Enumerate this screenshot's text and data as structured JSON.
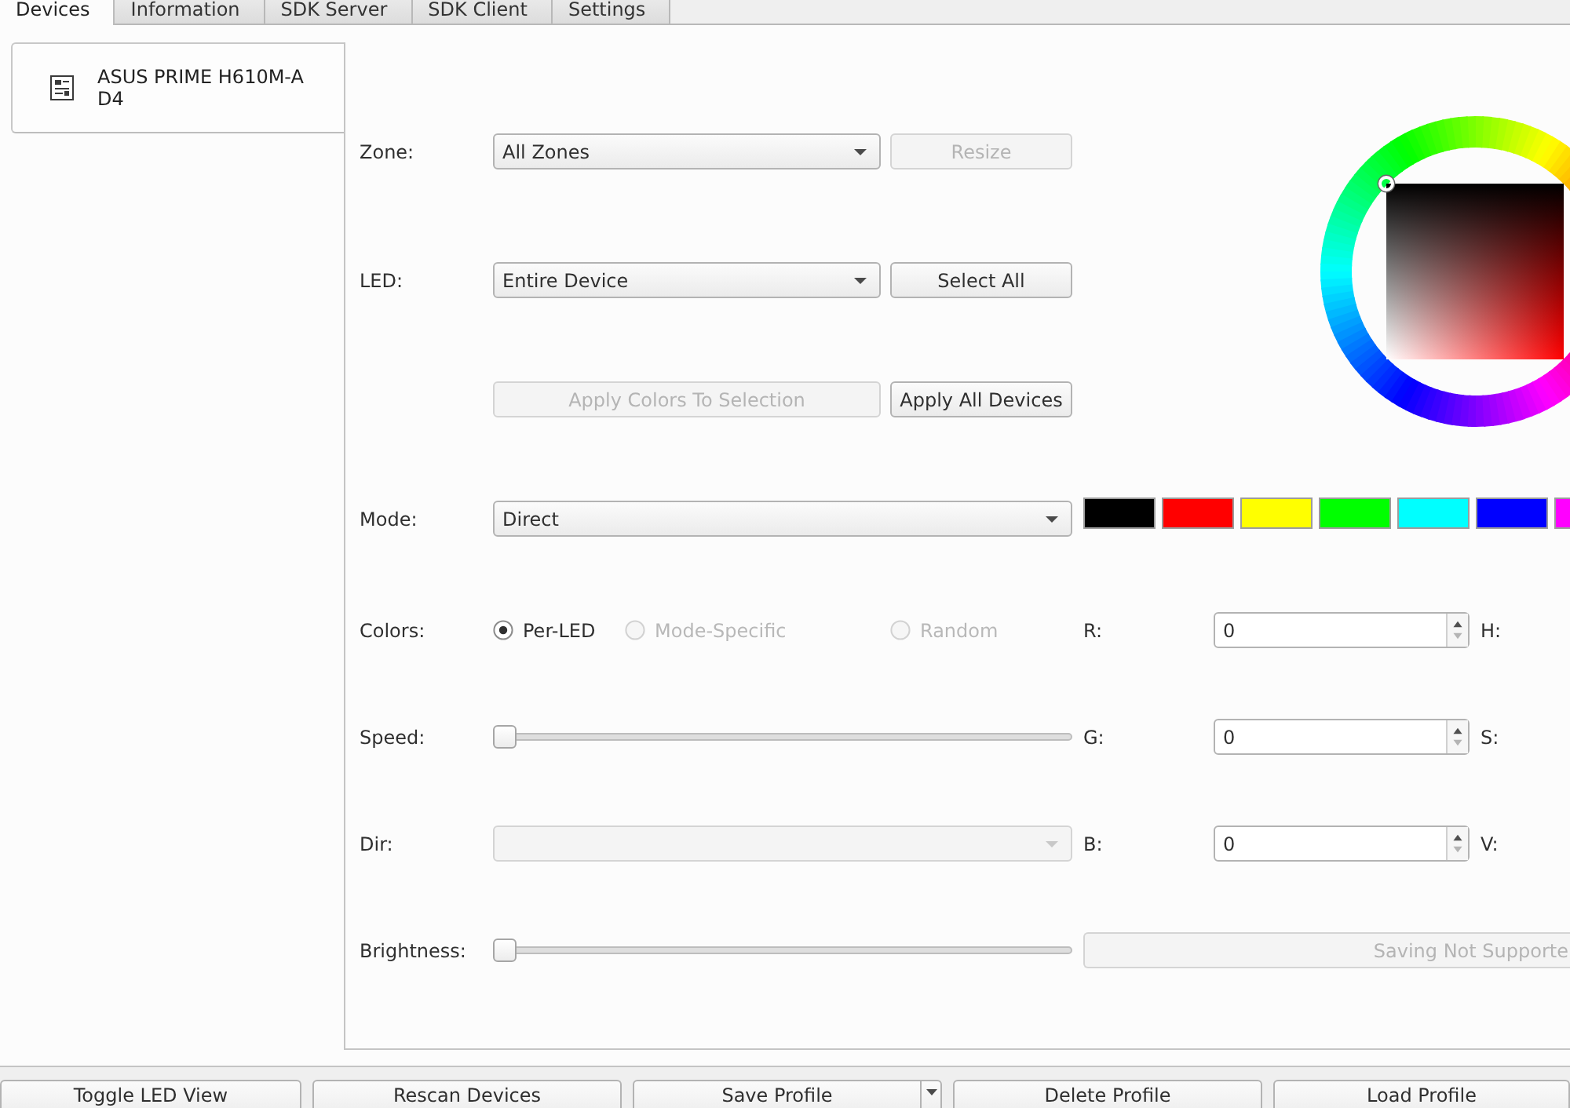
{
  "tabs": [
    {
      "label": "Devices",
      "selected": true
    },
    {
      "label": "Information",
      "selected": false
    },
    {
      "label": "SDK Server",
      "selected": false
    },
    {
      "label": "SDK Client",
      "selected": false
    },
    {
      "label": "Settings",
      "selected": false
    }
  ],
  "devices": [
    {
      "name": "ASUS PRIME H610M-A D4",
      "selected": true
    }
  ],
  "zone": {
    "label": "Zone:",
    "value": "All Zones",
    "disabled": false,
    "button": {
      "label": "Resize",
      "disabled": true
    }
  },
  "led": {
    "label": "LED:",
    "value": "Entire Device",
    "disabled": false,
    "button": {
      "label": "Select All",
      "disabled": false
    }
  },
  "apply_buttons": [
    {
      "label": "Apply Colors To Selection",
      "disabled": true
    },
    {
      "label": "Apply All Devices",
      "disabled": false
    }
  ],
  "mode": {
    "label": "Mode:",
    "value": "Direct",
    "disabled": false
  },
  "swatches": [
    {
      "color": "#000000"
    },
    {
      "color": "#ff0000"
    },
    {
      "color": "#ffff00"
    },
    {
      "color": "#00ff00"
    },
    {
      "color": "#00ffff"
    },
    {
      "color": "#0000ff"
    },
    {
      "color": "#ff00ff"
    }
  ],
  "colors": {
    "label": "Colors:",
    "options": [
      {
        "label": "Per-LED",
        "selected": true,
        "disabled": false
      },
      {
        "label": "Mode-Specific",
        "selected": false,
        "disabled": true
      },
      {
        "label": "Random",
        "selected": false,
        "disabled": true
      }
    ]
  },
  "speed": {
    "label": "Speed:",
    "level": 0
  },
  "dir": {
    "label": "Dir:",
    "disabled": true
  },
  "brightness": {
    "label": "Brightness:",
    "level": 0
  },
  "rgb": [
    {
      "label": "R:",
      "value": "0"
    },
    {
      "label": "G:",
      "value": "0"
    },
    {
      "label": "B:",
      "value": "0"
    }
  ],
  "hsv": [
    {
      "label": "H:"
    },
    {
      "label": "S:"
    },
    {
      "label": "V:"
    }
  ],
  "save_button": {
    "label": "Saving Not Supporte",
    "disabled": true
  },
  "bottom_buttons": [
    {
      "label": "Toggle LED View",
      "kind": "button"
    },
    {
      "label": "Rescan Devices",
      "kind": "button"
    },
    {
      "label": "Save Profile",
      "kind": "split"
    },
    {
      "label": "Delete Profile",
      "kind": "button"
    },
    {
      "label": "Load Profile",
      "kind": "button"
    }
  ]
}
